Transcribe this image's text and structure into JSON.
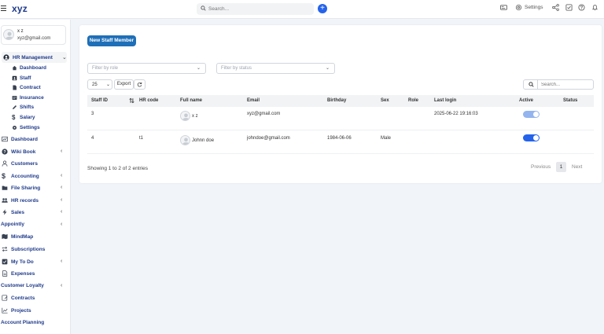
{
  "app": {
    "logo": "xyz",
    "search_placeholder": "Search...",
    "settings_label": "Settings",
    "accent_color": "#2563eb",
    "brand_color": "#1e3a8a"
  },
  "user": {
    "name": "x z",
    "email": "xyz@gmail.com"
  },
  "sidebar": {
    "hr": {
      "label": "HR Management",
      "sub": [
        {
          "label": "Dashboard"
        },
        {
          "label": "Staff"
        },
        {
          "label": "Contract"
        },
        {
          "label": "Insurance"
        },
        {
          "label": "Shifts"
        },
        {
          "label": "Salary"
        },
        {
          "label": "Settings"
        }
      ]
    },
    "items": [
      {
        "label": "Dashboard"
      },
      {
        "label": "Wiki Book"
      },
      {
        "label": "Customers"
      },
      {
        "label": "Accounting"
      },
      {
        "label": "File Sharing"
      },
      {
        "label": "HR records"
      },
      {
        "label": "Sales"
      },
      {
        "label": "Appointly"
      },
      {
        "label": "MindMap"
      },
      {
        "label": "Subscriptions"
      },
      {
        "label": "My To Do"
      },
      {
        "label": "Expenses"
      },
      {
        "label": "Customer Loyalty"
      },
      {
        "label": "Contracts"
      },
      {
        "label": "Projects"
      },
      {
        "label": "Account Planning"
      }
    ]
  },
  "main": {
    "new_button": "New Staff Member",
    "filter_role": "Filter by role",
    "filter_status": "Filter by status",
    "page_length": "25",
    "export_label": "Export",
    "table_search_placeholder": "Search...",
    "columns": [
      "Staff ID",
      "HR code",
      "Full name",
      "Email",
      "Birthday",
      "Sex",
      "Role",
      "Last login",
      "Active",
      "Status"
    ],
    "rows": [
      {
        "id": "3",
        "hr_code": "",
        "name": "x z",
        "email": "xyz@gmail.com",
        "birthday": "",
        "sex": "",
        "role": "",
        "last_login": "2025-06-22 19:16:03",
        "active": true,
        "status": ""
      },
      {
        "id": "4",
        "hr_code": "t1",
        "name": "Johnn doe",
        "email": "johndoe@gmail.com",
        "birthday": "1984-06-06",
        "sex": "Male",
        "role": "",
        "last_login": "",
        "active": true,
        "status": ""
      }
    ],
    "info": "Showing 1 to 2 of 2 entries",
    "pagination": {
      "previous": "Previous",
      "current": "1",
      "next": "Next"
    }
  }
}
